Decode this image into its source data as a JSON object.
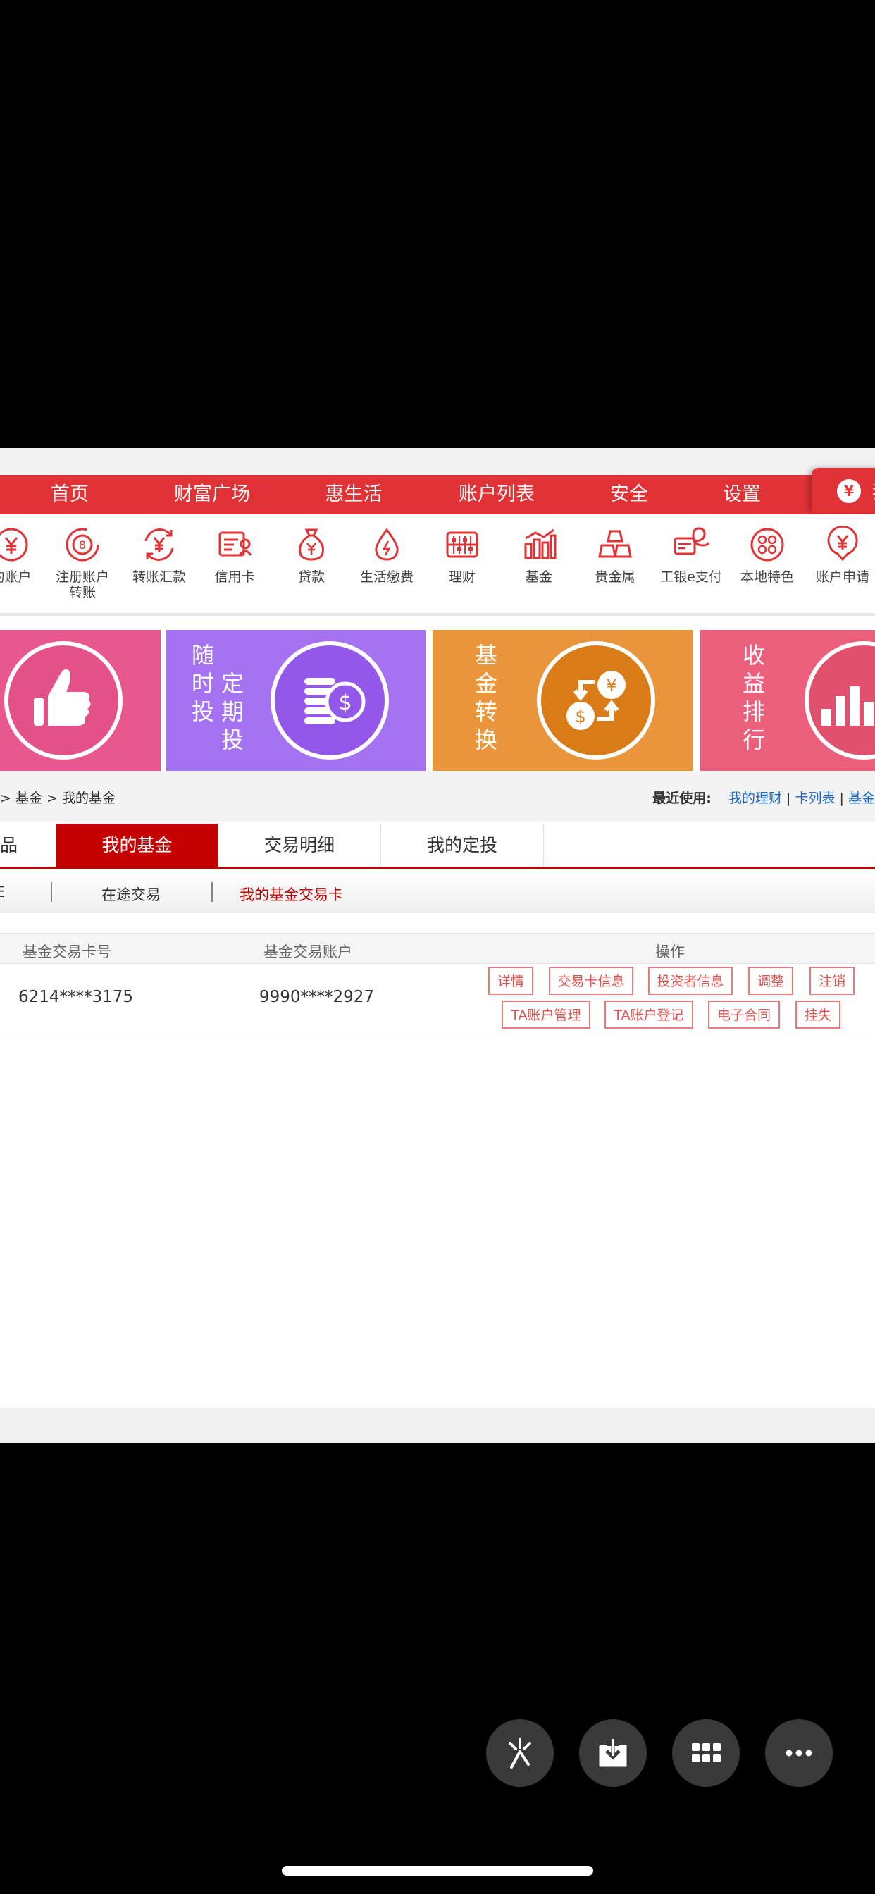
{
  "nav": {
    "items": [
      "首页",
      "财富广场",
      "惠生活",
      "账户列表",
      "安全",
      "设置"
    ],
    "badge_text": "¥",
    "badge_label": "我"
  },
  "quick_links": [
    {
      "label": "的账户",
      "icon": "yuan-circle-icon"
    },
    {
      "label": "注册账户\n转账",
      "icon": "dollar-circle-icon"
    },
    {
      "label": "转账汇款",
      "icon": "transfer-yuan-icon"
    },
    {
      "label": "信用卡",
      "icon": "credit-card-icon"
    },
    {
      "label": "贷款",
      "icon": "money-bag-icon"
    },
    {
      "label": "生活缴费",
      "icon": "water-drop-icon"
    },
    {
      "label": "理财",
      "icon": "abacus-icon"
    },
    {
      "label": "基金",
      "icon": "bar-chart-icon"
    },
    {
      "label": "贵金属",
      "icon": "gold-bars-icon"
    },
    {
      "label": "工银e支付",
      "icon": "e-pay-icon"
    },
    {
      "label": "本地特色",
      "icon": "local-dots-icon"
    },
    {
      "label": "账户申请",
      "icon": "yuan-account-icon"
    }
  ],
  "banners": [
    {
      "text": "",
      "color": "#e9578f",
      "icon": "thumbs-up-icon"
    },
    {
      "text": "随时定期投",
      "lines": [
        "随",
        "时 定",
        "投 期",
        "　 投"
      ],
      "color": "#a573f2",
      "icon": "coins-icon"
    },
    {
      "text": "基金转换",
      "lines": [
        "基",
        "金",
        "转",
        "换"
      ],
      "color": "#e8953b",
      "icon": "exchange-icon"
    },
    {
      "text": "收益排行",
      "lines": [
        "收",
        "益",
        "排",
        "行"
      ],
      "color": "#eb5f7c",
      "icon": "ranking-icon"
    }
  ],
  "breadcrumb": "> 基金 > 我的基金",
  "recent": {
    "label": "最近使用:",
    "links": [
      "我的理财",
      "卡列表",
      "基金"
    ]
  },
  "tabs": [
    "品",
    "我的基金",
    "交易明细",
    "我的定投"
  ],
  "subtabs": [
    "E",
    "在途交易",
    "我的基金交易卡"
  ],
  "table": {
    "headers": [
      "基金交易卡号",
      "基金交易账户",
      "操作"
    ],
    "row": {
      "card": "6214****3175",
      "account": "9990****2927",
      "actions_row1": [
        "详情",
        "交易卡信息",
        "投资者信息",
        "调整",
        "注销"
      ],
      "actions_row2": [
        "TA账户管理",
        "TA账户登记",
        "电子合同",
        "挂失"
      ]
    }
  },
  "colors": {
    "brand_red": "#e13236",
    "active_tab": "#c40000",
    "link_blue": "#1a66c9"
  },
  "floating_buttons": [
    "share-icon",
    "download-icon",
    "grid-icon",
    "more-icon"
  ]
}
